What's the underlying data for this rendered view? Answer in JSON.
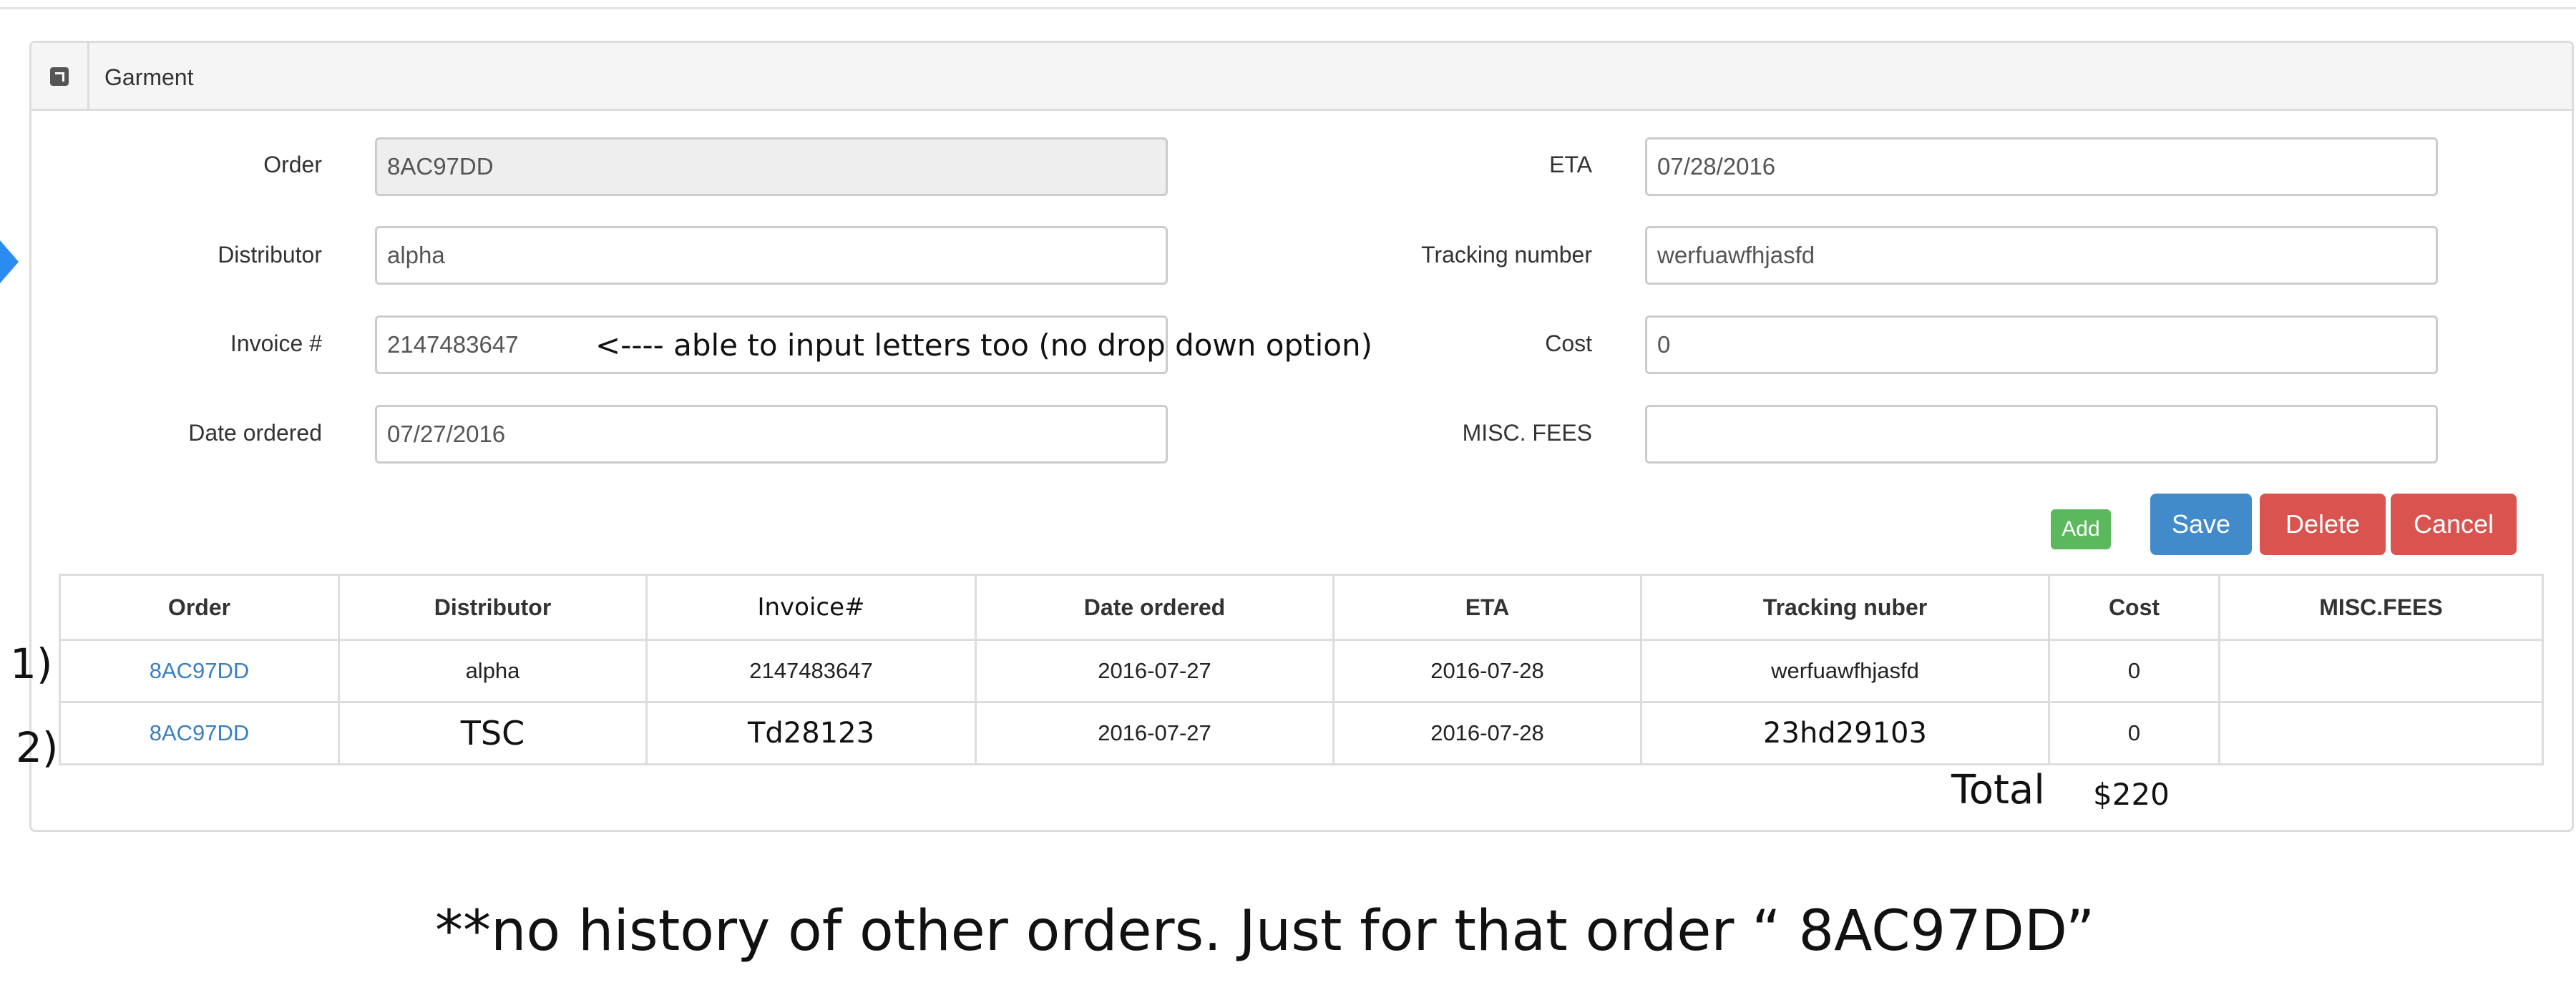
{
  "panel": {
    "title": "Garment",
    "icon": "external-link-icon"
  },
  "form": {
    "order": {
      "label": "Order",
      "value": "8AC97DD"
    },
    "distributor": {
      "label": "Distributor",
      "value": "alpha"
    },
    "invoice": {
      "label": "Invoice #",
      "value": "2147483647"
    },
    "date_ordered": {
      "label": "Date ordered",
      "value": "07/27/2016"
    },
    "eta": {
      "label": "ETA",
      "value": "07/28/2016"
    },
    "tracking": {
      "label": "Tracking number",
      "value": "werfuawfhjasfd"
    },
    "cost": {
      "label": "Cost",
      "value": "0"
    },
    "misc_fees": {
      "label": "MISC. FEES",
      "value": ""
    }
  },
  "annotation_note": "<---- able to input letters too (no drop down option)",
  "buttons": {
    "add": "Add",
    "save": "Save",
    "delete": "Delete",
    "cancel": "Cancel"
  },
  "table": {
    "headers": [
      "Order",
      "Distributor",
      "Invoice#",
      "Date ordered",
      "ETA",
      "Tracking nuber",
      "Cost",
      "MISC.FEES"
    ],
    "rows": [
      [
        "8AC97DD",
        "alpha",
        "2147483647",
        "2016-07-27",
        "2016-07-28",
        "werfuawfhjasfd",
        "0",
        ""
      ],
      [
        "8AC97DD",
        "TSC",
        "Td28123",
        "2016-07-27",
        "2016-07-28",
        "23hd29103",
        "0",
        ""
      ]
    ]
  },
  "row_markers": [
    "1)",
    "2)"
  ],
  "total": {
    "label": "Total",
    "value": "$220"
  },
  "footnote": "**no history of other orders. Just for that order “ 8AC97DD”",
  "colors": {
    "link": "#3a7fc1",
    "save": "#428bca",
    "danger": "#d9534f",
    "add": "#5cb85c",
    "arrow": "#2a8cf0"
  }
}
